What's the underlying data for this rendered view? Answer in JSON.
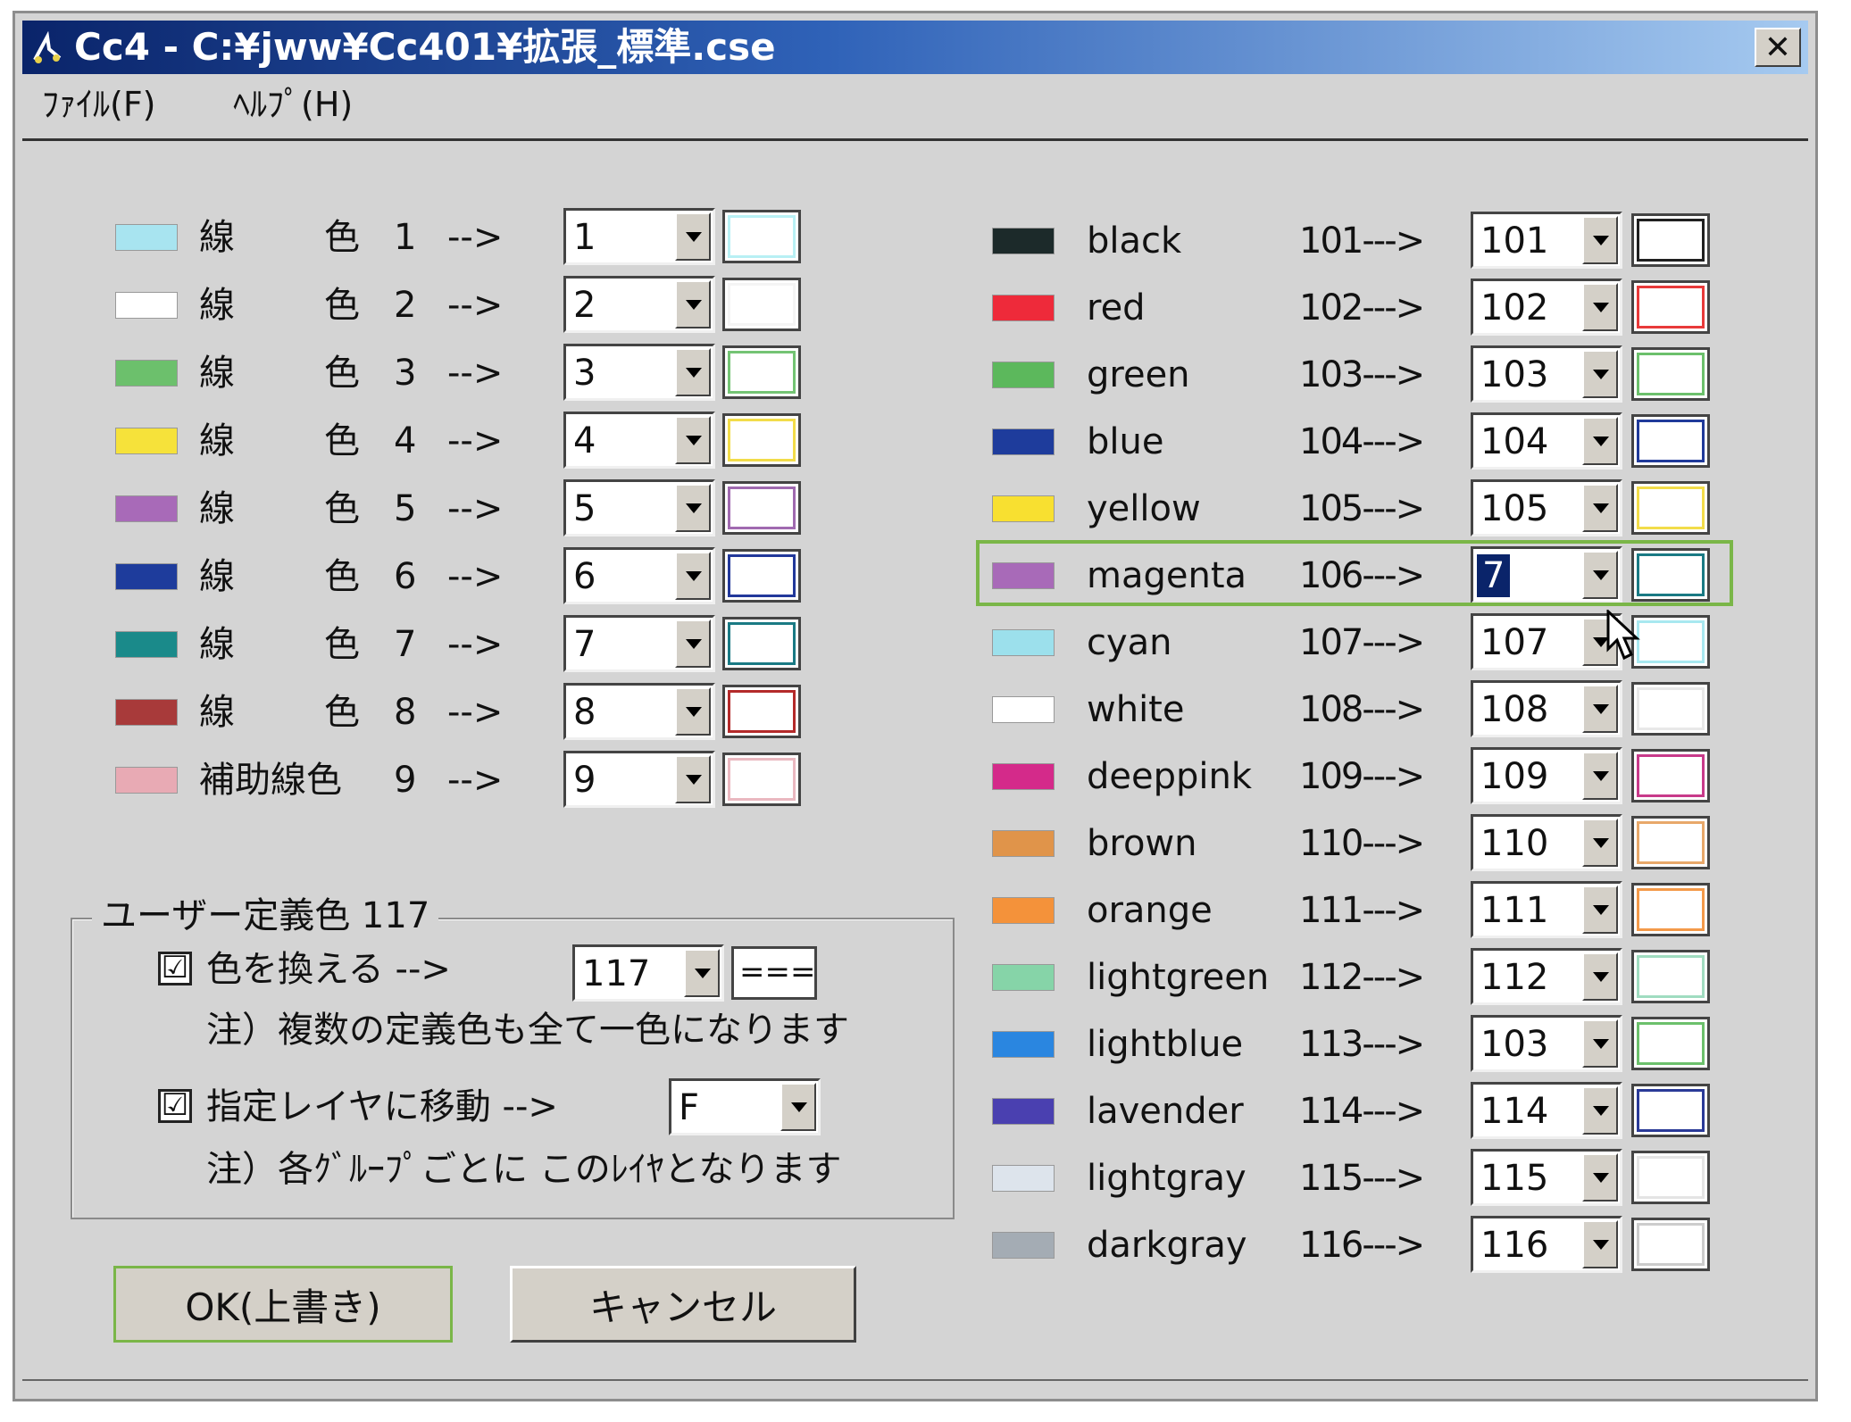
{
  "window": {
    "title": "Cc4 - C:¥jww¥Cc401¥拡張_標準.cse",
    "menu": [
      "ﾌｧｲﾙ(F)",
      "ﾍﾙﾌﾟ(H)"
    ]
  },
  "left_rows": [
    {
      "label_a": "線",
      "label_b": "色",
      "num": "1",
      "arrow": "-->",
      "value": "1",
      "swatch": "#a8e4f0",
      "preview": "#b8f0f4"
    },
    {
      "label_a": "線",
      "label_b": "色",
      "num": "2",
      "arrow": "-->",
      "value": "2",
      "swatch": "#ffffff",
      "preview": "#f4f4f4"
    },
    {
      "label_a": "線",
      "label_b": "色",
      "num": "3",
      "arrow": "-->",
      "value": "3",
      "swatch": "#6cc06c",
      "preview": "#74c474"
    },
    {
      "label_a": "線",
      "label_b": "色",
      "num": "4",
      "arrow": "-->",
      "value": "4",
      "swatch": "#f6e23a",
      "preview": "#f2dc4a"
    },
    {
      "label_a": "線",
      "label_b": "色",
      "num": "5",
      "arrow": "-->",
      "value": "5",
      "swatch": "#a86ab8",
      "preview": "#a06ab0"
    },
    {
      "label_a": "線",
      "label_b": "色",
      "num": "6",
      "arrow": "-->",
      "value": "6",
      "swatch": "#1e3c9c",
      "preview": "#22389a"
    },
    {
      "label_a": "線",
      "label_b": "色",
      "num": "7",
      "arrow": "-->",
      "value": "7",
      "swatch": "#1a8a8a",
      "preview": "#1a7a84"
    },
    {
      "label_a": "線",
      "label_b": "色",
      "num": "8",
      "arrow": "-->",
      "value": "8",
      "swatch": "#a83a3a",
      "preview": "#b42a2a"
    },
    {
      "label_a": "補助線色",
      "label_b": "",
      "num": "9",
      "arrow": "-->",
      "value": "9",
      "swatch": "#e8aab4",
      "preview": "#eab8c0"
    }
  ],
  "right_rows": [
    {
      "name": "black",
      "code": "101--->",
      "value": "101",
      "swatch": "#1c2a2a",
      "preview": "#202020"
    },
    {
      "name": "red",
      "code": "102--->",
      "value": "102",
      "swatch": "#ee2a3a",
      "preview": "#e83a3a"
    },
    {
      "name": "green",
      "code": "103--->",
      "value": "103",
      "swatch": "#5cb85c",
      "preview": "#6cc06c"
    },
    {
      "name": "blue",
      "code": "104--->",
      "value": "104",
      "swatch": "#1e3c9c",
      "preview": "#203a9a"
    },
    {
      "name": "yellow",
      "code": "105--->",
      "value": "105",
      "swatch": "#f8e030",
      "preview": "#f2dc4a"
    },
    {
      "name": "magenta",
      "code": "106--->",
      "value": "7",
      "swatch": "#a86ab8",
      "preview": "#1a7a84",
      "selected": true
    },
    {
      "name": "cyan",
      "code": "107--->",
      "value": "107",
      "swatch": "#9ce0ec",
      "preview": "#a8e8f0"
    },
    {
      "name": "white",
      "code": "108--->",
      "value": "108",
      "swatch": "#ffffff",
      "preview": "#e8e8e8"
    },
    {
      "name": "deeppink",
      "code": "109--->",
      "value": "109",
      "swatch": "#d42a8a",
      "preview": "#c83a8a"
    },
    {
      "name": "brown",
      "code": "110--->",
      "value": "110",
      "swatch": "#e0944a",
      "preview": "#e8a86a"
    },
    {
      "name": "orange",
      "code": "111--->",
      "value": "111",
      "swatch": "#f4923a",
      "preview": "#f49a4a"
    },
    {
      "name": "lightgreen",
      "code": "112--->",
      "value": "112",
      "swatch": "#86d4a8",
      "preview": "#a0dcc0"
    },
    {
      "name": "lightblue",
      "code": "113--->",
      "value": "103",
      "swatch": "#2a86e0",
      "preview": "#6cc06c"
    },
    {
      "name": "lavender",
      "code": "114--->",
      "value": "114",
      "swatch": "#4a40b0",
      "preview": "#2a3a98"
    },
    {
      "name": "lightgray",
      "code": "115--->",
      "value": "115",
      "swatch": "#dde4ec",
      "preview": "#e4e4e4"
    },
    {
      "name": "darkgray",
      "code": "116--->",
      "value": "116",
      "swatch": "#a4acb4",
      "preview": "#cccccc"
    }
  ],
  "user_group": {
    "title": "ユーザー定義色 117",
    "replace_checked": "☑",
    "replace_label": "色を換える -->",
    "replace_value": "117",
    "replace_preview": "===",
    "note1": "注）複数の定義色も全て一色になります",
    "move_checked": "☑",
    "move_label": "指定レイヤに移動 -->",
    "move_value": "F",
    "note2": "注）各ｸﾞﾙｰﾌﾟごとに このﾚｲﾔとなります"
  },
  "buttons": {
    "ok": "OK(上書き)",
    "cancel": "キャンセル"
  },
  "accent": {
    "highlight": "#7ab648",
    "selection": "#0a246a"
  }
}
